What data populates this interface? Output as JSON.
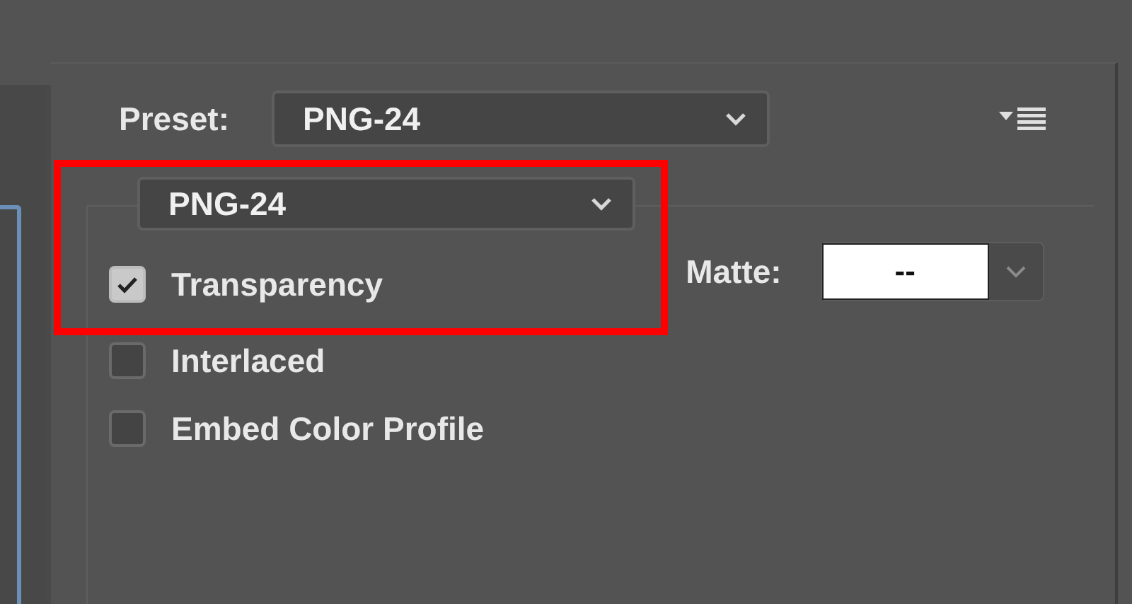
{
  "preset": {
    "label": "Preset:",
    "value": "PNG-24"
  },
  "format": {
    "value": "PNG-24"
  },
  "options": [
    {
      "label": "Transparency",
      "checked": true
    },
    {
      "label": "Interlaced",
      "checked": false
    },
    {
      "label": "Embed Color Profile",
      "checked": false
    }
  ],
  "matte": {
    "label": "Matte:",
    "value": "--"
  }
}
